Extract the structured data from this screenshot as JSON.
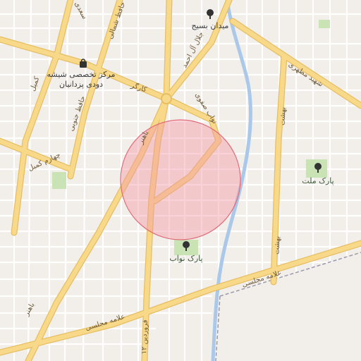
{
  "map": {
    "labels": {
      "poi_medical_line1": "مرکز تخصصی شیشه",
      "poi_medical_line2": "دودی پزدانیان",
      "maidan_basij": "میدان بسیج",
      "park_mellat": "پارک ملت",
      "park_navab": "پارک نواب",
      "road_motahari": "شهید مطهری",
      "road_allameh_majlesi_east": "علامه مجلسی",
      "road_allameh_majlesi_west": "علامه مجلسی",
      "road_bahonar_north": "باهنر",
      "road_bahonar_south": "باهنر",
      "road_karegar": "کارگر",
      "road_jalal_al_ahmad": "جلال آل احمد",
      "road_navab_safavi": "نواب صفوی",
      "road_behesht_north": "بهشت",
      "road_behesht_south": "بهشت",
      "road_kamil": "کمیل",
      "road_chaharom_kamil": "چهارم کمیل",
      "road_hafez_shomali": "حافظ شمالی",
      "road_hafez_jonobi": "حافظ جنوبی",
      "road_saadi": "سعدی",
      "road_farvardin": "۱۲ فروردین"
    },
    "colors": {
      "background": "#f2efea",
      "major_road": "#f8d98a",
      "major_road_casing": "#e6be63",
      "minor_road": "#ffffff",
      "river": "#a9c8ea",
      "park": "#c9e3b4",
      "highlight_fill": "#f29aa5",
      "highlight_stroke": "#e06c7b",
      "rail": "#9a9aae"
    },
    "icons": {
      "poi": "shopping-bag-icon",
      "square": "tree-icon",
      "parks": "tree-icon"
    }
  }
}
